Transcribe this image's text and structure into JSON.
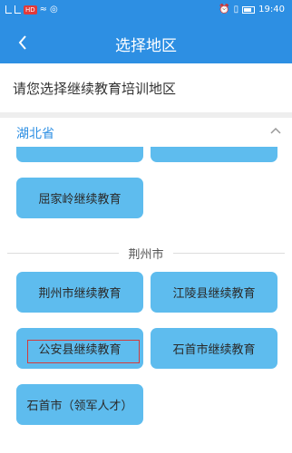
{
  "statusbar": {
    "time": "19:40",
    "badge": "HD"
  },
  "header": {
    "title": "选择地区"
  },
  "prompt": "请您选择继续教育培训地区",
  "province": {
    "name": "湖北省"
  },
  "sections": [
    {
      "name": "",
      "buttons": [
        "",
        "",
        "屈家岭继续教育"
      ]
    },
    {
      "name": "荆州市",
      "buttons": [
        "荆州市继续教育",
        "江陵县继续教育",
        "公安县继续教育",
        "石首市继续教育",
        "石首市（领军人才）"
      ]
    }
  ],
  "colors": {
    "header_bg": "#2d8fe3",
    "button_bg": "#5ebcee",
    "highlight": "#d43b3b"
  }
}
